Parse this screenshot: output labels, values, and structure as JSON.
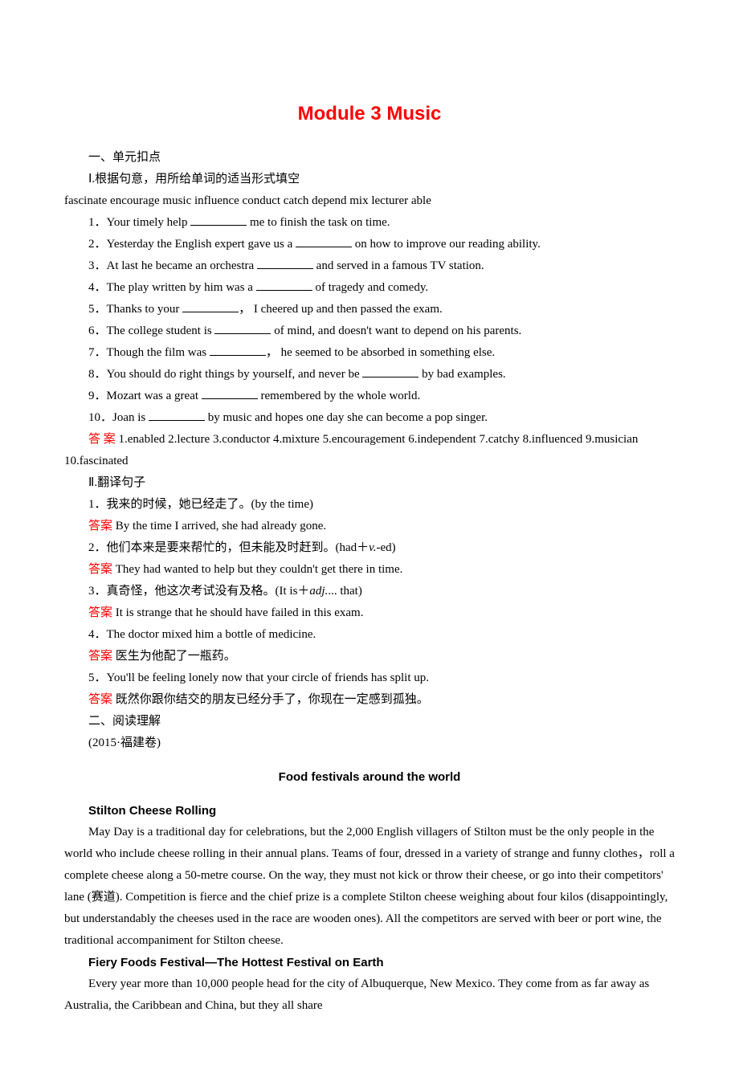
{
  "title": "Module 3  Music",
  "section1": {
    "heading": "一、单元扣点",
    "sub1": "Ⅰ.根据句意，用所给单词的适当形式填空",
    "wordbank": "fascinate   encourage   music   influence   conduct   catch   depend   mix  lecturer  able",
    "q1a": "1．Your timely help ",
    "q1b": " me to finish the task on time.",
    "q2a": "2．Yesterday the English expert gave us a ",
    "q2b": " on how to improve our reading ability.",
    "q3a": "3．At last he became an orchestra ",
    "q3b": " and served in a famous TV station.",
    "q4a": "4．The play written by him was a ",
    "q4b": " of tragedy and comedy.",
    "q5a": "5．Thanks to your ",
    "q5b": "， I cheered up and then passed the exam.",
    "q6a": "6．The college student is ",
    "q6b": " of mind, and doesn't want to depend on his parents.",
    "q7a": "7．Though the film was ",
    "q7b": "， he seemed to be absorbed in something else.",
    "q8a": "8．You should do right things by yourself, and never be ",
    "q8b": " by bad examples.",
    "q9a": "9．Mozart was a great ",
    "q9b": " remembered by the whole world.",
    "q10a": "10．Joan is ",
    "q10b": " by music and hopes one day she can become a pop singer.",
    "ans_label": "答 案",
    "ans_text": "  1.enabled  2.lecture  3.conductor  4.mixture  5.encouragement 6.independent  7.catchy  8.influenced  9.musician  10.fascinated"
  },
  "section2": {
    "sub2": "Ⅱ.翻译句子",
    "q1": "1．我来的时候，她已经走了。(by the time)",
    "a1_label": "答案",
    "a1_text": "  By the time I arrived, she had already gone.",
    "q2": "2．他们本来是要来帮忙的，但未能及时赶到。(had＋",
    "q2_it": "v.",
    "q2_end": "-ed)",
    "a2_label": "答案",
    "a2_text": "  They had wanted to help but they couldn't get there in time.",
    "q3": "3．真奇怪，他这次考试没有及格。(It is＋",
    "q3_it": "adj.",
    "q3_end": "... that)",
    "a3_label": "答案",
    "a3_text": "  It is strange that he should have failed in this exam.",
    "q4": "4．The doctor mixed him a bottle of medicine.",
    "a4_label": "答案",
    "a4_text": "  医生为他配了一瓶药。",
    "q5": "5．You'll be feeling lonely now that your circle of friends has split up.",
    "a5_label": "答案",
    "a5_text": "  既然你跟你结交的朋友已经分手了，你现在一定感到孤独。"
  },
  "section3": {
    "heading": "二、阅读理解",
    "source": "(2015·福建卷)",
    "passage_title": "Food festivals around the world",
    "sub1": "Stilton Cheese Rolling",
    "p1": "May Day is a traditional day for celebrations, but the 2,000 English villagers of Stilton must be the only people in the world who include cheese rolling in their annual plans. Teams of four, dressed in a variety of strange and funny clothes，roll a complete cheese along a 50-metre course. On the way, they must not kick or throw their cheese, or go into their competitors' lane (赛道). Competition is fierce and the chief prize is a complete Stilton cheese weighing about four kilos (disappointingly, but understandably the cheeses used in the race are wooden ones). All the competitors are served with beer or port wine, the traditional accompaniment for Stilton cheese.",
    "sub2": "Fiery Foods Festival—The Hottest Festival on Earth",
    "p2": "Every year more than 10,000 people head for the city of Albuquerque, New Mexico. They come from as far away as Australia, the Caribbean and China, but they all share"
  }
}
